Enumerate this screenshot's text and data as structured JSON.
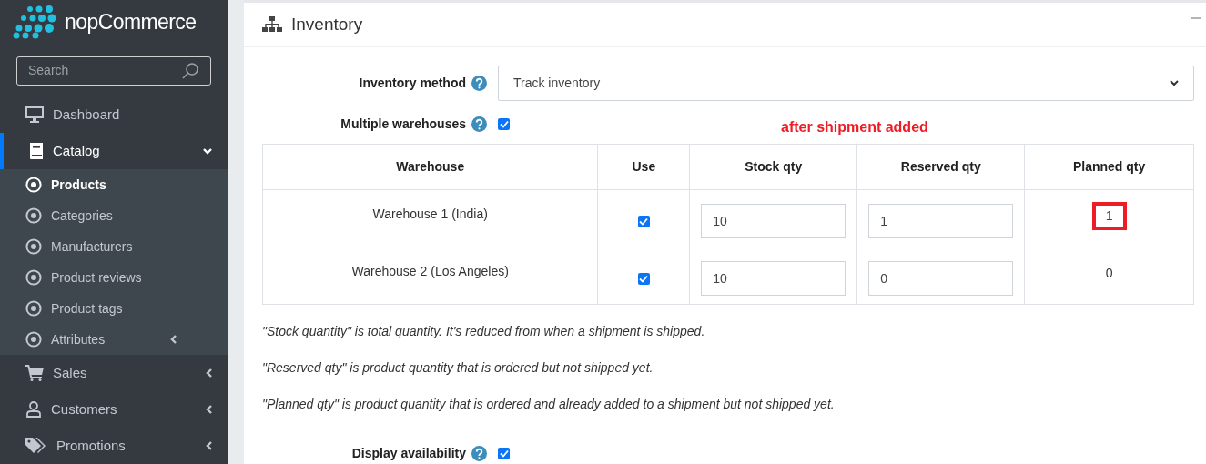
{
  "sidebar": {
    "logo": "nopCommerce",
    "search": {
      "placeholder": "Search"
    },
    "items": [
      {
        "label": "Dashboard",
        "has_submenu": false,
        "selected": false
      },
      {
        "label": "Catalog",
        "has_submenu": true,
        "expanded": true,
        "selected": true,
        "children": [
          {
            "label": "Products",
            "selected": true,
            "has_submenu": false
          },
          {
            "label": "Categories",
            "selected": false,
            "has_submenu": false
          },
          {
            "label": "Manufacturers",
            "selected": false,
            "has_submenu": false
          },
          {
            "label": "Product reviews",
            "selected": false,
            "has_submenu": false
          },
          {
            "label": "Product tags",
            "selected": false,
            "has_submenu": false
          },
          {
            "label": "Attributes",
            "selected": false,
            "has_submenu": true
          }
        ]
      },
      {
        "label": "Sales",
        "has_submenu": true,
        "expanded": false,
        "selected": false
      },
      {
        "label": "Customers",
        "has_submenu": true,
        "expanded": false,
        "selected": false
      },
      {
        "label": "Promotions",
        "has_submenu": true,
        "expanded": false,
        "selected": false
      }
    ]
  },
  "card": {
    "title": "Inventory",
    "inventory_method": {
      "label": "Inventory method",
      "value": "Track inventory"
    },
    "multiple_warehouses": {
      "label": "Multiple warehouses",
      "checked": true
    },
    "annotation": "after shipment added",
    "table": {
      "columns": [
        "Warehouse",
        "Use",
        "Stock qty",
        "Reserved qty",
        "Planned qty"
      ],
      "rows": [
        {
          "warehouse": "Warehouse 1 (India)",
          "use": true,
          "stock_qty": "10",
          "reserved_qty": "1",
          "planned_qty": "1",
          "highlighted": true
        },
        {
          "warehouse": "Warehouse 2 (Los Angeles)",
          "use": true,
          "stock_qty": "10",
          "reserved_qty": "0",
          "planned_qty": "0",
          "highlighted": false
        }
      ]
    },
    "notes": [
      "\"Stock quantity\" is total quantity. It's reduced from when a shipment is shipped.",
      "\"Reserved qty\" is product quantity that is ordered but not shipped yet.",
      "\"Planned qty\" is product quantity that is ordered and already added to a shipment but not shipped yet."
    ],
    "display_availability": {
      "label": "Display availability",
      "checked": true
    }
  }
}
